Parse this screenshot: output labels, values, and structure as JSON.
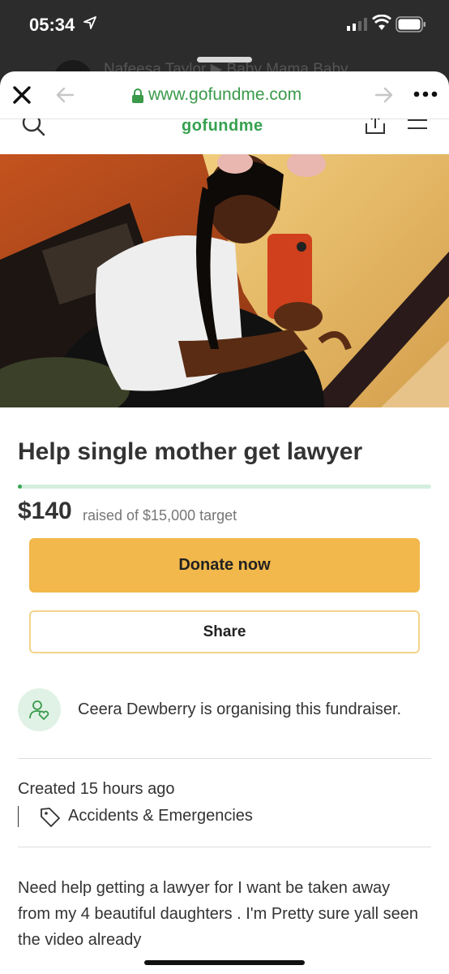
{
  "status_bar": {
    "time": "05:34"
  },
  "background_app": {
    "title_text": "Nafeesa Taylor ▶ Baby Mama Baby"
  },
  "browser": {
    "url": "www.gofundme.com"
  },
  "site": {
    "logo": "gofundme"
  },
  "campaign": {
    "title": "Help single mother get lawyer",
    "amount": "$140",
    "raised_text": "raised of $15,000 target",
    "progress_percent": 0.93,
    "donate_label": "Donate now",
    "share_label": "Share",
    "organiser_text": "Ceera Dewberry is organising this fundraiser.",
    "created": "Created 15 hours ago",
    "category": "Accidents & Emergencies",
    "description": "Need help getting a lawyer for I want be taken away from my 4 beautiful daughters . I'm  Pretty sure yall seen the video already"
  },
  "colors": {
    "brand_green": "#36a150",
    "donate_yellow": "#f2b84b",
    "share_border": "#f2d38a"
  },
  "icons": [
    "location-arrow-icon",
    "signal-icon",
    "wifi-icon",
    "battery-icon",
    "close-icon",
    "back-arrow-icon",
    "lock-icon",
    "forward-arrow-icon",
    "more-icon",
    "search-icon",
    "share-icon",
    "menu-icon",
    "organiser-icon",
    "tag-icon"
  ]
}
